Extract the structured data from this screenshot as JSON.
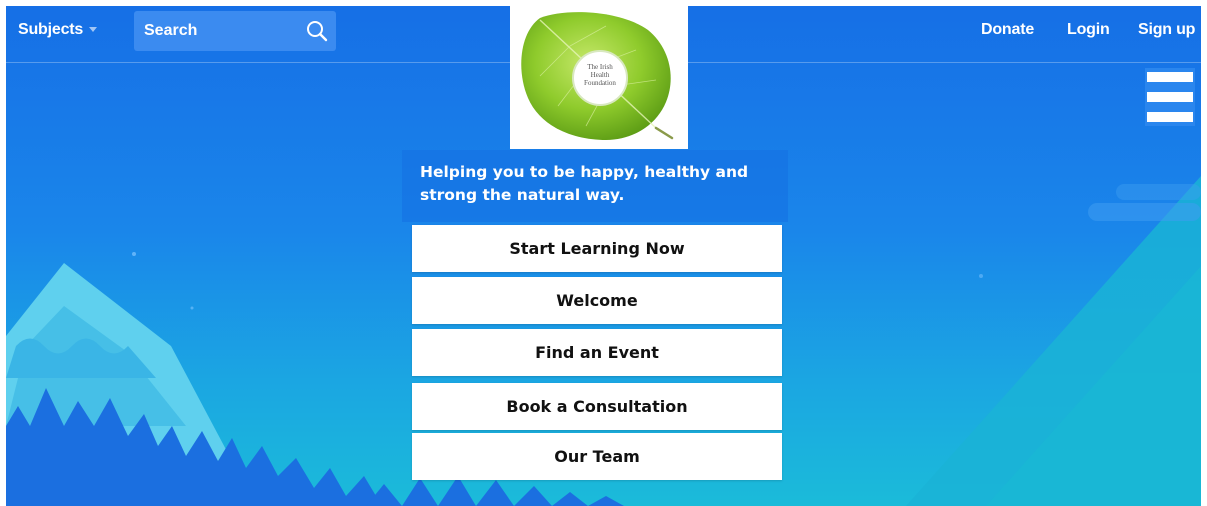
{
  "nav": {
    "subjects_label": "Subjects",
    "search_label": "Search",
    "donate_label": "Donate",
    "login_label": "Login",
    "signup_label": "Sign up"
  },
  "logo": {
    "text_line1": "The Irish",
    "text_line2": "Health",
    "text_line3": "Foundation",
    "icon": "leaf-logo"
  },
  "hero": {
    "tagline": "Helping you to be happy, healthy and strong the natural way."
  },
  "menu": {
    "items": [
      {
        "label": "Start Learning Now"
      },
      {
        "label": "Welcome"
      },
      {
        "label": "Find an Event"
      },
      {
        "label": "Book a Consultation"
      },
      {
        "label": "Our Team"
      }
    ]
  },
  "icons": {
    "search": "search-icon",
    "menu": "hamburger-menu-icon",
    "dropdown": "caret-down-icon"
  },
  "colors": {
    "background_top": "#166fe6",
    "background_bottom": "#1bbbd9",
    "button_bg": "#ffffff",
    "text_light": "#ffffff"
  }
}
